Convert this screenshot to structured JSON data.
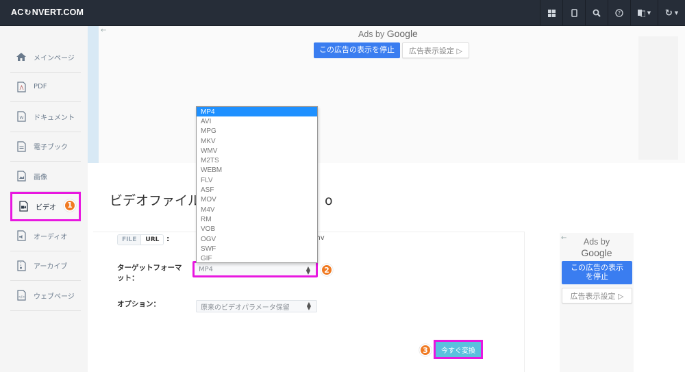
{
  "topbar": {
    "logo_left": "AC",
    "logo_right": "NVERT.COM",
    "icons": [
      "grid-icon",
      "tablet-icon",
      "search-icon",
      "help-icon",
      "language-icon",
      "refresh-icon"
    ]
  },
  "sidebar": {
    "items": [
      {
        "label": "メインページ",
        "icon": "home-icon"
      },
      {
        "label": "PDF",
        "icon": "pdf-file-icon"
      },
      {
        "label": "ドキュメント",
        "icon": "word-file-icon"
      },
      {
        "label": "電子ブック",
        "icon": "ebook-file-icon"
      },
      {
        "label": "画像",
        "icon": "image-file-icon"
      },
      {
        "label": "ビデオ",
        "icon": "video-file-icon",
        "active": true,
        "badge": "1"
      },
      {
        "label": "オーディオ",
        "icon": "audio-file-icon"
      },
      {
        "label": "アーカイブ",
        "icon": "archive-file-icon"
      },
      {
        "label": "ウェブページ",
        "icon": "webpage-file-icon"
      }
    ]
  },
  "ad_top": {
    "ads_by": "Ads by",
    "google": "Google",
    "stop_label": "この広告の表示を停止",
    "settings_label": "広告表示設定 ▷"
  },
  "ad_side": {
    "ads_by": "Ads by",
    "google": "Google",
    "stop_label": "この広告の表示を停止",
    "settings_label": "広告表示設定 ▷"
  },
  "main": {
    "title": "ビデオファイルを",
    "title_tail": "o",
    "source_tabs": {
      "file": "FILE",
      "url": "URL"
    },
    "colon": ":",
    "url_tail": "mv",
    "target_format_label": "ターゲットフォーマット：",
    "target_format_value": "MP4",
    "target_badge": "2",
    "option_label": "オプション：",
    "option_value": "原来のビデオパラメータ保留",
    "convert_label": "今すぐ変換",
    "convert_badge": "3"
  },
  "format_dropdown": {
    "selected": "MP4",
    "options": [
      "MP4",
      "AVI",
      "MPG",
      "MKV",
      "WMV",
      "M2TS",
      "WEBM",
      "FLV",
      "ASF",
      "MOV",
      "M4V",
      "RM",
      "VOB",
      "OGV",
      "SWF",
      "GIF"
    ]
  },
  "colors": {
    "highlight": "#e817e0",
    "badge": "#f07a22",
    "ad_button": "#3a7df0",
    "convert_button": "#5bc0de",
    "topbar": "#262d38"
  }
}
